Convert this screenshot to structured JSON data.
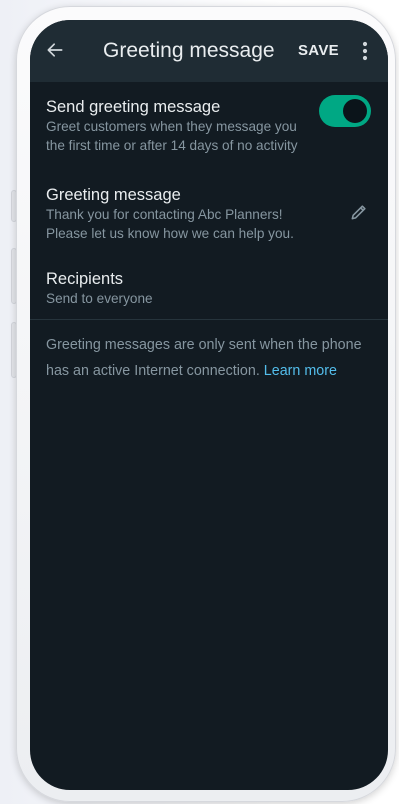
{
  "appbar": {
    "title": "Greeting message",
    "save_label": "SAVE"
  },
  "send_greeting": {
    "title": "Send greeting message",
    "subtitle_line1": "Greet customers when they message you",
    "subtitle_line2": "the first time or after 14 days of no activity",
    "enabled": true
  },
  "greeting_message": {
    "title": "Greeting message",
    "text_line1": "Thank you for contacting Abc Planners!",
    "text_line2": "Please let us know how we can help you."
  },
  "recipients": {
    "title": "Recipients",
    "value": "Send to everyone"
  },
  "info": {
    "text": "Greeting messages are only sent when the phone has an active Internet connection.",
    "link": "Learn more"
  },
  "colors": {
    "accent": "#00a884",
    "link": "#53bdeb",
    "background": "#121b22",
    "appbar": "#1f2c34"
  },
  "icons": {
    "back": "arrow-left-icon",
    "more": "more-vertical-icon",
    "edit": "pencil-icon"
  }
}
